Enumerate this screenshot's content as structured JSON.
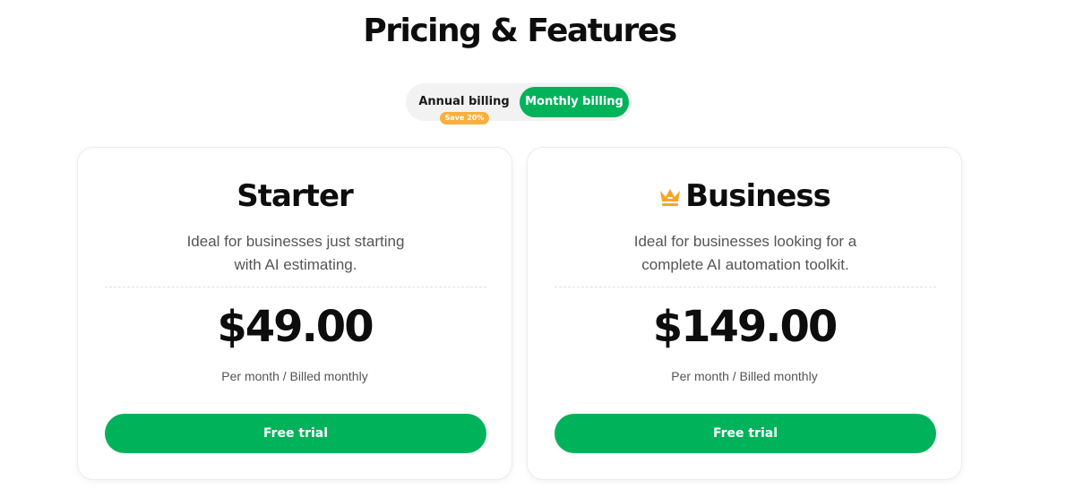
{
  "page": {
    "title": "Pricing & Features"
  },
  "billing_toggle": {
    "annual_label": "Annual billing",
    "monthly_label": "Monthly billing",
    "save_badge": "Save 20%",
    "selected": "Monthly billing"
  },
  "plans": [
    {
      "name": "Starter",
      "description_line1": "Ideal for businesses just starting",
      "description_line2": "with AI estimating.",
      "price": "$49.00",
      "billing_note": "Per month / Billed monthly",
      "cta_label": "Free trial"
    },
    {
      "name": "Business",
      "icon": "crown-icon",
      "description_line1": "Ideal for businesses looking for a",
      "description_line2": "complete AI automation toolkit.",
      "price": "$149.00",
      "billing_note": "Per month / Billed monthly",
      "cta_label": "Free trial"
    }
  ],
  "colors": {
    "accent_green": "#00b25a",
    "badge_orange": "#f8b03c",
    "crown_orange": "#f5a623"
  }
}
